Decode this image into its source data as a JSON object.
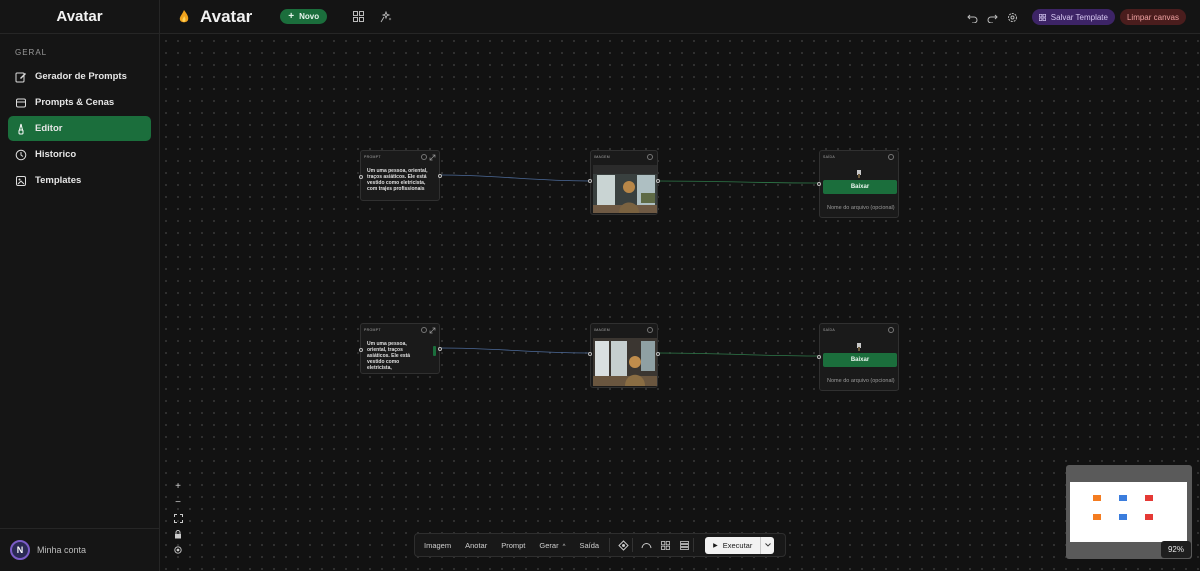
{
  "sidebar": {
    "brand": "Avatar",
    "section": "GERAL",
    "items": [
      {
        "label": "Gerador de Prompts",
        "icon": "edit-icon",
        "active": false
      },
      {
        "label": "Prompts & Cenas",
        "icon": "layers-icon",
        "active": false
      },
      {
        "label": "Editor",
        "icon": "brush-icon",
        "active": true
      },
      {
        "label": "Historico",
        "icon": "clock-icon",
        "active": false
      },
      {
        "label": "Templates",
        "icon": "template-icon",
        "active": false
      }
    ],
    "account_initial": "N",
    "account_label": "Minha conta"
  },
  "topbar": {
    "title": "Avatar",
    "new_button": "Novo",
    "save_template": "Salvar Template",
    "clear_canvas": "Limpar canvas"
  },
  "nodes": {
    "prompt_label": "PROMPT",
    "image_label": "IMAGEM",
    "output_label": "SAÍDA",
    "prompt1_text": "Um uma pessoa, oriental, traços asiáticos. Ele está vestido como eletricista, com trajes profissionais",
    "prompt2_text": "Um uma pessoa, oriental, traços asiáticos. Ele está vestido como eletricista,",
    "download_label": "Baixar",
    "filename_placeholder": "Nome do arquivo (opcional)"
  },
  "toolbar": {
    "items": [
      "Imagem",
      "Anotar",
      "Prompt",
      "Gerar",
      "Saída"
    ],
    "execute": "Executar"
  },
  "zoom": "92%",
  "colors": {
    "accent_green": "#1b6e3c",
    "template_purple": "#3d2466",
    "clear_red": "#4a1d1d"
  }
}
